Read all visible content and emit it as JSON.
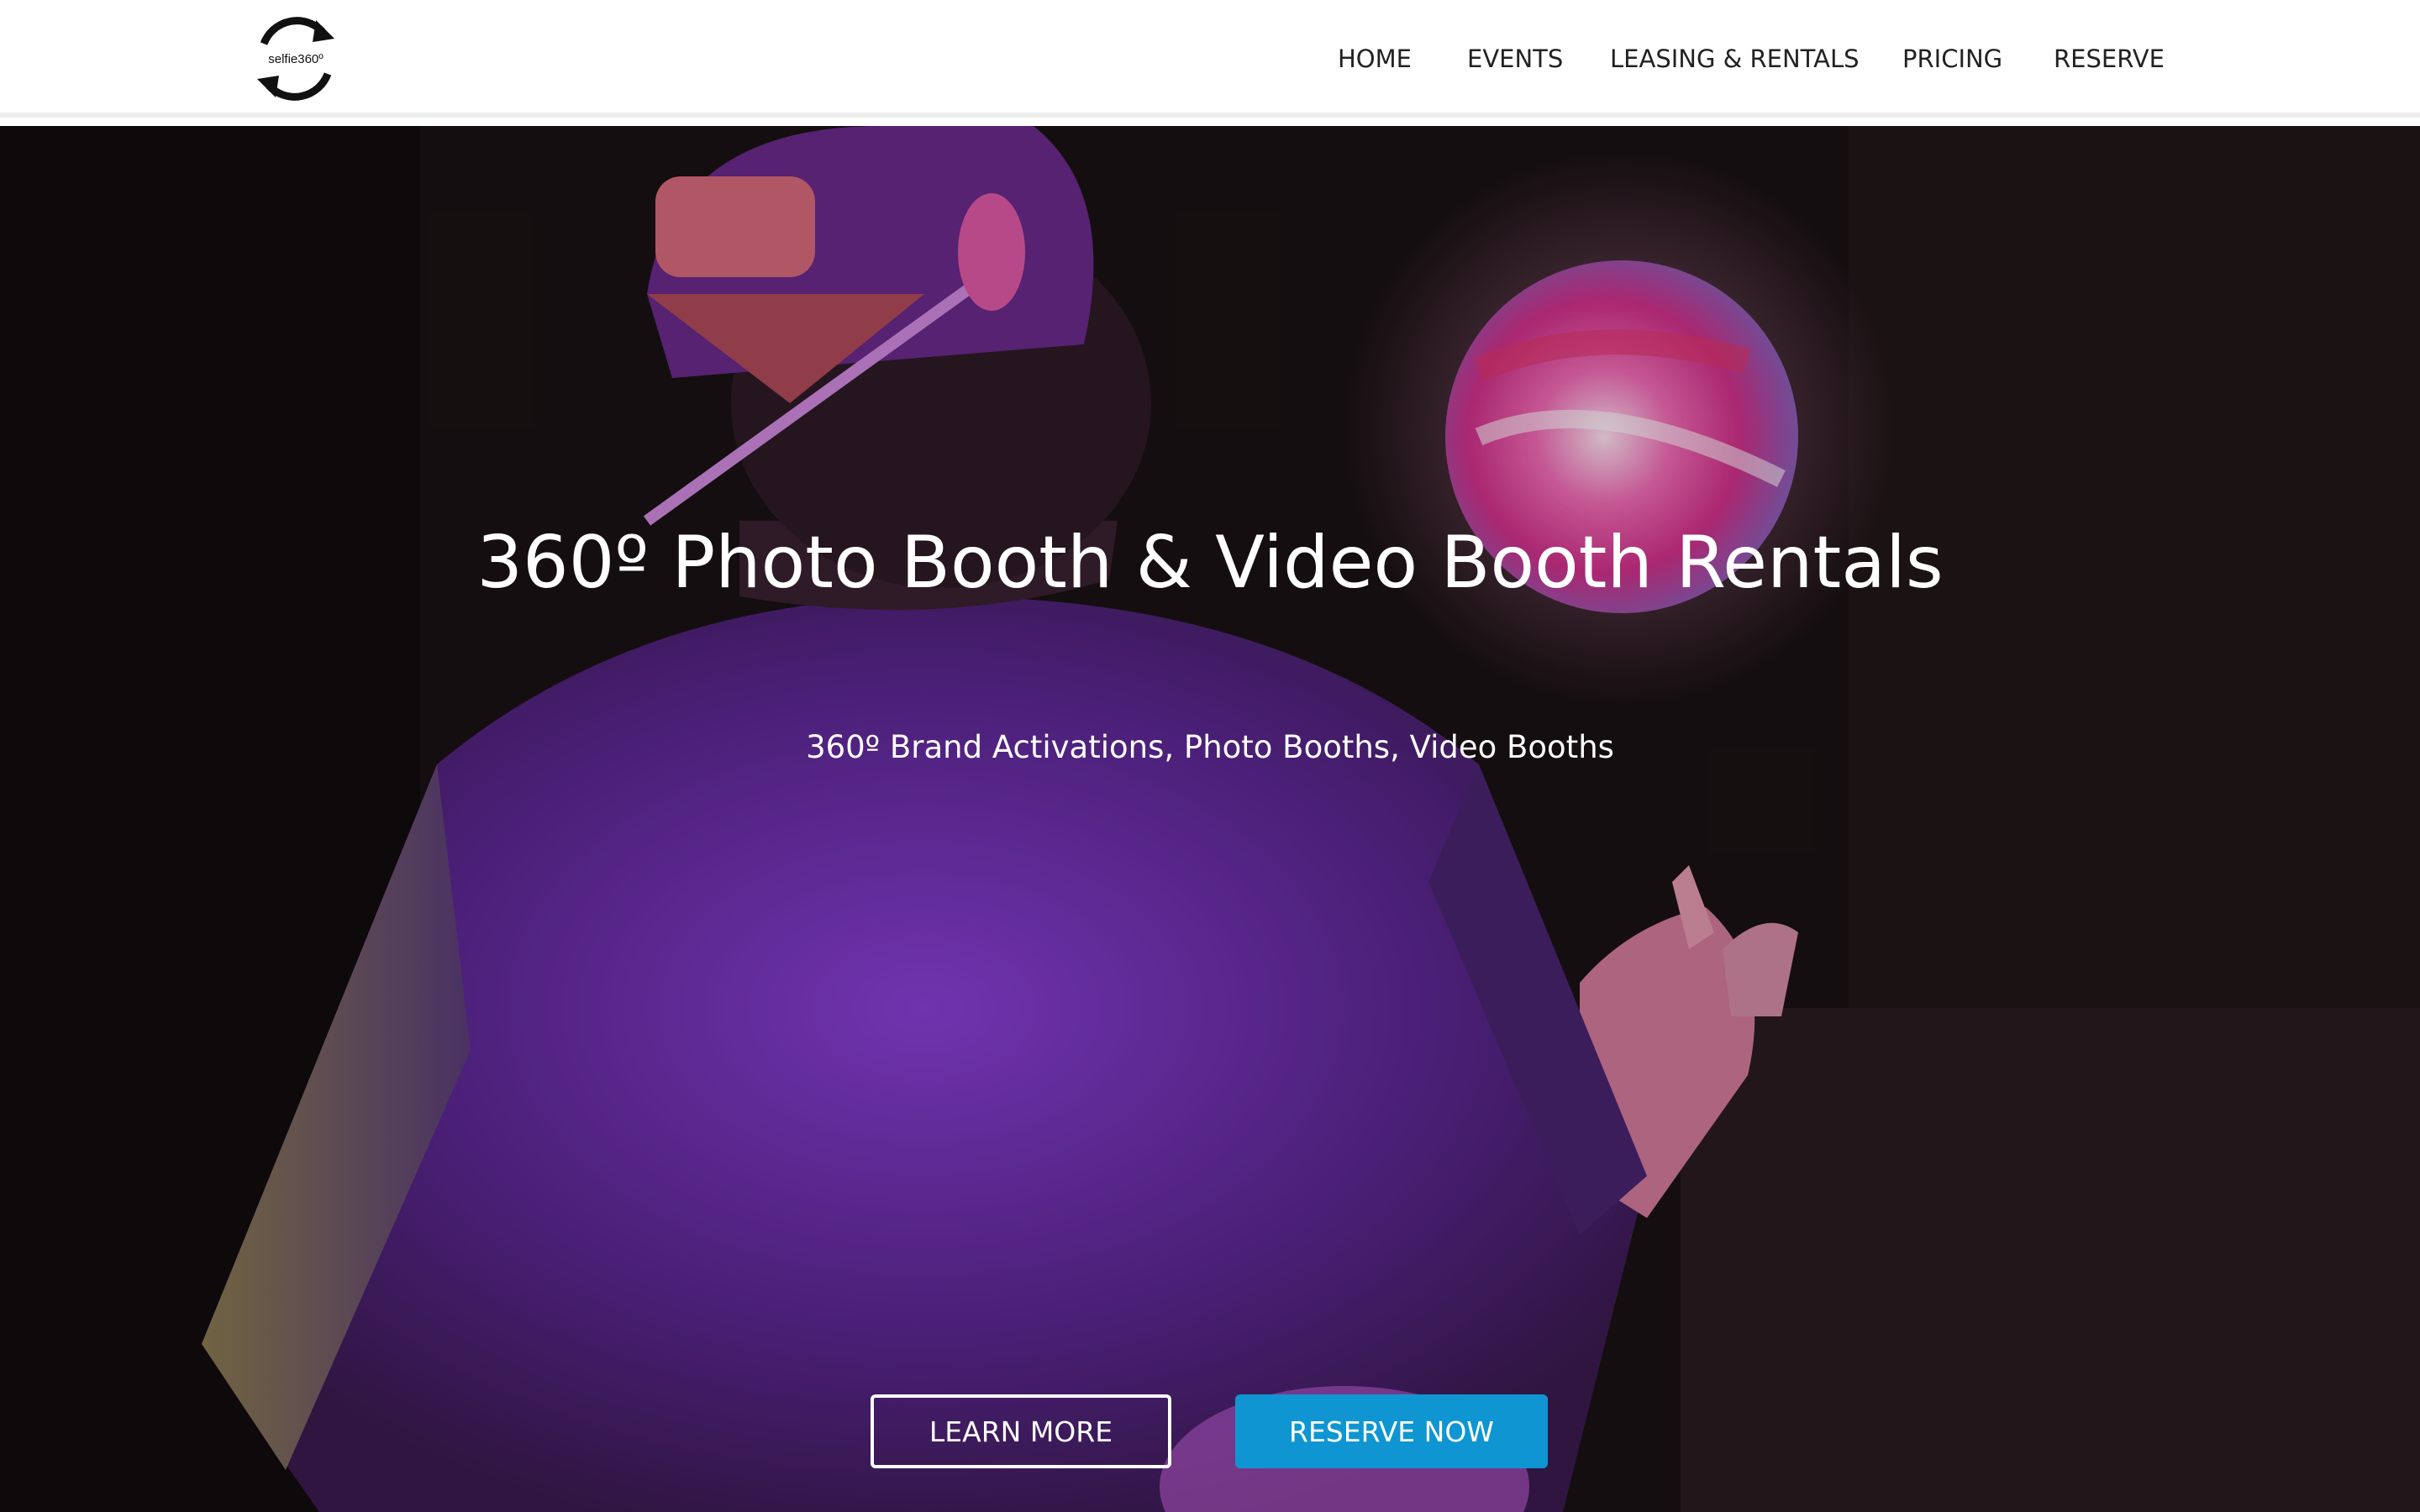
{
  "logo": {
    "text": "selfie360º",
    "icon": "circular-arrows-icon"
  },
  "nav": {
    "items": [
      {
        "label": "HOME"
      },
      {
        "label": "EVENTS"
      },
      {
        "label": "LEASING & RENTALS"
      },
      {
        "label": "PRICING"
      },
      {
        "label": "RESERVE"
      }
    ]
  },
  "hero": {
    "title": "360º Photo Booth & Video Booth Rentals",
    "subtitle": "360º Brand Activations, Photo Booths, Video Booths",
    "learn_more_label": "LEARN MORE",
    "reserve_now_label": "RESERVE NOW"
  },
  "colors": {
    "accent": "#0f96d2",
    "nav_text": "#222222",
    "hero_text": "#ffffff"
  }
}
